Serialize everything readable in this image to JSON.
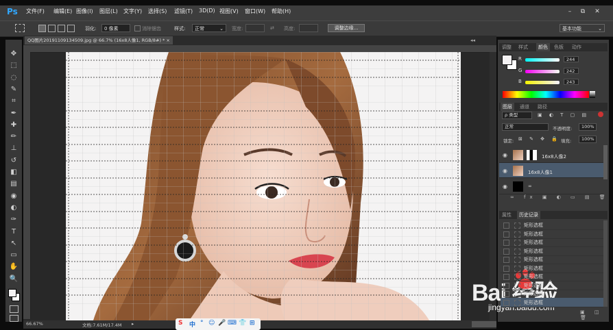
{
  "app": {
    "logo": "Ps"
  },
  "menu": [
    "文件(F)",
    "编辑(E)",
    "图像(I)",
    "图层(L)",
    "文字(Y)",
    "选择(S)",
    "滤镜(T)",
    "3D(D)",
    "视图(V)",
    "窗口(W)",
    "帮助(H)"
  ],
  "window_controls": {
    "minimize": "–",
    "restore": "⧉",
    "close": "✕"
  },
  "options": {
    "feather_label": "羽化:",
    "feather_value": "0 像素",
    "antialias_label": "消除锯齿",
    "style_label": "样式:",
    "style_value": "正常",
    "width_label": "宽度:",
    "height_label": "高度:",
    "refine_button": "调整边缘...",
    "workspace": "基本功能"
  },
  "document": {
    "tab_title": "QQ图片20191109134509.jpg @ 66.7% (16x8人像1, RGB/8#) *",
    "tab_close": "×",
    "zoom": "66.67%",
    "doc_info": "文档:7.61M/17.4M"
  },
  "tools": [
    "move-tool-icon",
    "marquee-tool-icon",
    "lasso-tool-icon",
    "quick-select-tool-icon",
    "crop-tool-icon",
    "eyedropper-tool-icon",
    "healing-tool-icon",
    "brush-tool-icon",
    "stamp-tool-icon",
    "history-brush-tool-icon",
    "eraser-tool-icon",
    "gradient-tool-icon",
    "blur-tool-icon",
    "dodge-tool-icon",
    "pen-tool-icon",
    "type-tool-icon",
    "path-select-tool-icon",
    "shape-tool-icon",
    "hand-tool-icon",
    "zoom-tool-icon"
  ],
  "tool_glyphs": [
    "✥",
    "⬚",
    "◌",
    "✎",
    "⌗",
    "✒",
    "✚",
    "✏",
    "⊥",
    "↺",
    "◧",
    "▤",
    "◉",
    "◐",
    "✑",
    "T",
    "↖",
    "▭",
    "✋",
    "🔍"
  ],
  "color_panel": {
    "tabs": [
      "调整",
      "样式",
      "颜色",
      "色板",
      "动作"
    ],
    "active_tab": "颜色",
    "r_label": "R",
    "g_label": "G",
    "b_label": "B",
    "r_value": "244",
    "g_value": "242",
    "b_value": "243"
  },
  "layers_panel": {
    "tabs": [
      "图层",
      "通道",
      "路径"
    ],
    "active_tab": "图层",
    "kind_filter": "ρ 类型",
    "blend_mode": "正常",
    "opacity_label": "不透明度:",
    "opacity_value": "100%",
    "lock_label": "锁定:",
    "fill_label": "填充:",
    "fill_value": "100%",
    "layers": [
      {
        "name": "16x8人像2",
        "selected": false
      },
      {
        "name": "16x8人像1",
        "selected": true
      }
    ]
  },
  "history_panel": {
    "tabs": [
      "属性",
      "历史记录"
    ],
    "active_tab": "历史记录",
    "items": [
      "矩形选框",
      "矩形选框",
      "矩形选框",
      "矩形选框",
      "矩形选框",
      "矩形选框",
      "矩形选框",
      "矩形选框",
      "矩形选框",
      "矩形选框"
    ]
  },
  "ime_bar": {
    "logo": "S",
    "items": [
      "中",
      "°",
      "☺",
      "🎤",
      "⌨",
      "👕",
      "⊞"
    ]
  },
  "watermark": {
    "text": "Bai 经验",
    "url": "jingyan.baidu.com"
  },
  "colors": {
    "accent": "#31a8ff",
    "selected_layer": "#4a5b6e",
    "swatch_fg": "#f4f2f3",
    "canvas_bg": "#282828"
  }
}
